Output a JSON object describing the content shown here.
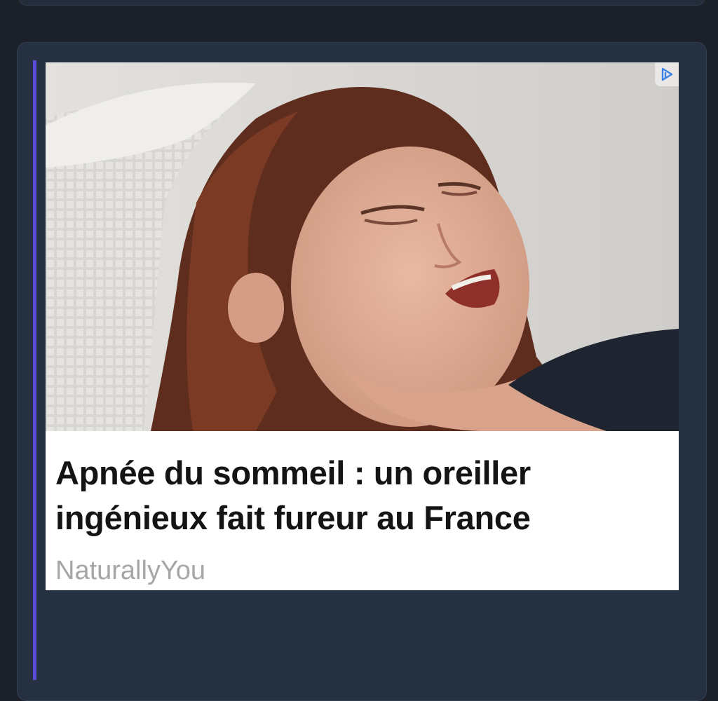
{
  "ad": {
    "image_alt": "Woman sleeping with mouth open on a white pillow",
    "headline_line1": "Apnée du sommeil : un oreiller",
    "headline_line2": "ingénieux fait fureur au France",
    "source": "NaturallyYou",
    "choices_icon": "ad-choices-icon"
  },
  "colors": {
    "background": "#1c2129",
    "card": "#253040",
    "accent": "#5a4ad8",
    "ad_choices": "#3b82e8"
  }
}
